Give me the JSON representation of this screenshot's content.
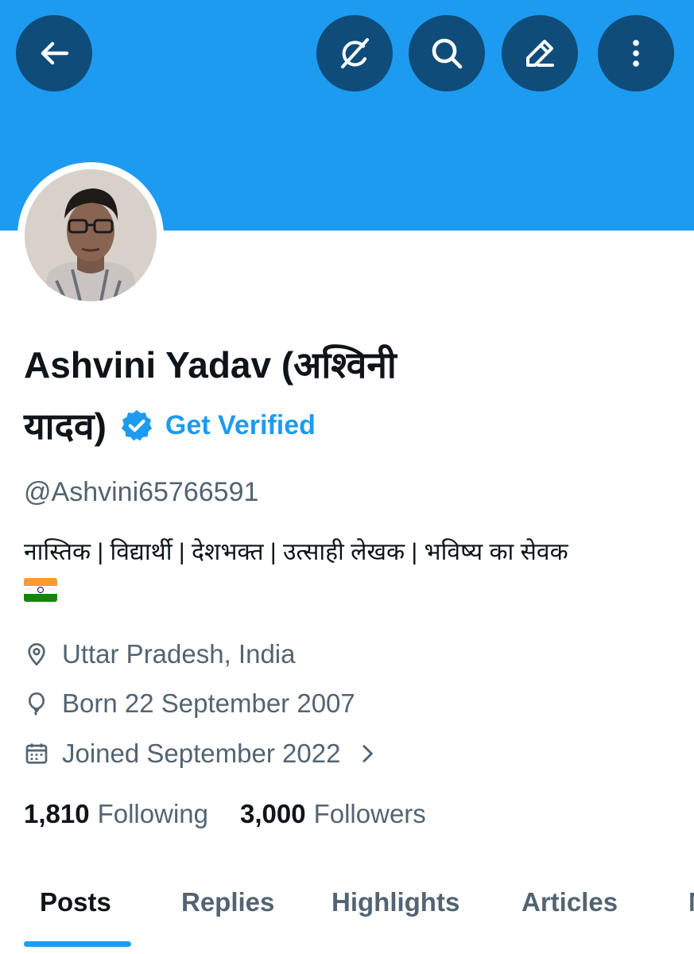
{
  "header": {
    "back_icon": "arrow-left-icon",
    "grok_icon": "grok-icon",
    "search_icon": "search-icon",
    "edit_icon": "edit-pencil-icon",
    "more_icon": "more-vertical-icon"
  },
  "colors": {
    "banner": "#1d9bf0",
    "button_bg": "#0f4c7a",
    "accent": "#1d9bf0",
    "secondary_text": "#536471",
    "primary_text": "#0f1419"
  },
  "profile": {
    "name_line1": "Ashvini Yadav (अश्विनी",
    "name_line2": "यादव)",
    "get_verified": "Get Verified",
    "handle": "@Ashvini65766591",
    "bio": "नास्तिक | विद्यार्थी | देशभक्त | उत्साही लेखक | भविष्य का सेवक",
    "bio_emoji": "indian-flag",
    "location": "Uttar Pradesh, India",
    "born": "Born 22 September 2007",
    "joined": "Joined September 2022"
  },
  "stats": {
    "following_count": "1,810",
    "following_label": "Following",
    "followers_count": "3,000",
    "followers_label": "Followers"
  },
  "tabs": [
    {
      "label": "Posts",
      "active": true
    },
    {
      "label": "Replies",
      "active": false
    },
    {
      "label": "Highlights",
      "active": false
    },
    {
      "label": "Articles",
      "active": false
    },
    {
      "label": "M",
      "active": false
    }
  ]
}
